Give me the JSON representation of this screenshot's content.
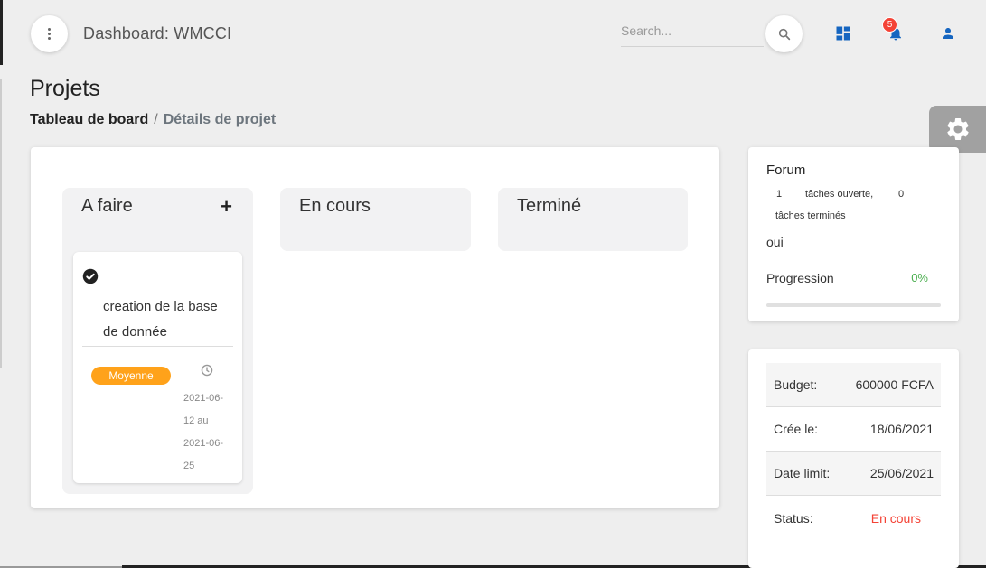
{
  "header": {
    "brand": "Dashboard: WMCCI",
    "search_placeholder": "Search...",
    "notification_count": "5",
    "icons": [
      "more-vert-icon",
      "search-icon",
      "dashboard-icon",
      "bell-icon",
      "person-icon"
    ]
  },
  "page": {
    "title": "Projets",
    "breadcrumb": {
      "root": "Tableau de board",
      "separator": "/",
      "current": "Détails de projet"
    }
  },
  "board": {
    "columns": [
      {
        "title": "A faire",
        "add_label": "+"
      },
      {
        "title": "En cours"
      },
      {
        "title": "Terminé"
      }
    ],
    "task": {
      "title": "creation de la base de donnée",
      "priority": "Moyenne",
      "date": "2021-06-12 au 2021-06-25"
    }
  },
  "forum": {
    "title": "Forum",
    "open_count": "1",
    "open_label": "tâches ouverte,",
    "done_count": "0",
    "done_label": "tâches terminés",
    "oui": "oui",
    "progress_label": "Progression",
    "progress_value": "0%",
    "progress_fraction": 0
  },
  "details": {
    "budget_label": "Budget:",
    "budget_value": "600000 FCFA",
    "created_label": "Crée le:",
    "created_value": "18/06/2021",
    "limit_label": "Date limit:",
    "limit_value": "25/06/2021",
    "status_label": "Status:",
    "status_value": "En cours"
  },
  "colors": {
    "accent_blue": "#1565c0",
    "badge_red": "#f44336",
    "priority_orange": "#ffa21a",
    "success_green": "#4caf50"
  }
}
